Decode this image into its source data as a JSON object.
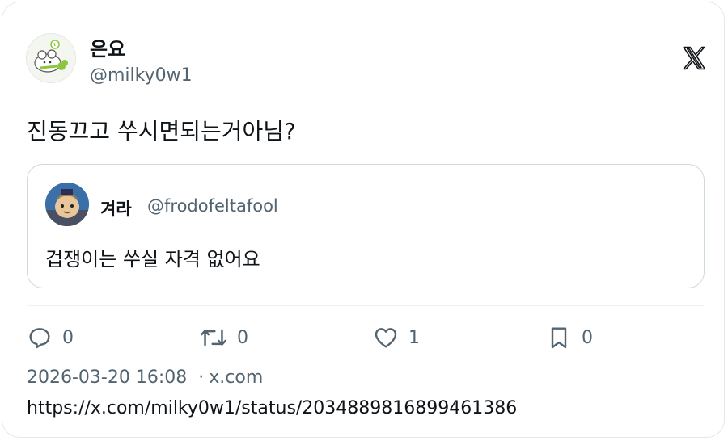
{
  "author": {
    "display_name": "은요",
    "handle": "@milky0w1"
  },
  "tweet": {
    "text": "진동끄고 쑤시면되는거아님?"
  },
  "quoted": {
    "display_name": "겨라",
    "handle": "@frodofeltafool",
    "text": "겁쟁이는 쑤실 자격 없어요"
  },
  "actions": {
    "reply_count": "0",
    "retweet_count": "0",
    "like_count": "1",
    "bookmark_count": "0"
  },
  "meta": {
    "timestamp": "2026-03-20 16:08",
    "separator": "·",
    "source": "x.com",
    "url": "https://x.com/milky0w1/status/2034889816899461386"
  },
  "icons": {
    "brand": "x-logo-icon",
    "reply": "reply-icon",
    "retweet": "retweet-icon",
    "like": "heart-icon",
    "bookmark": "bookmark-icon"
  },
  "colors": {
    "text_primary": "#0f1419",
    "text_secondary": "#536471",
    "border": "#cfd9de"
  }
}
